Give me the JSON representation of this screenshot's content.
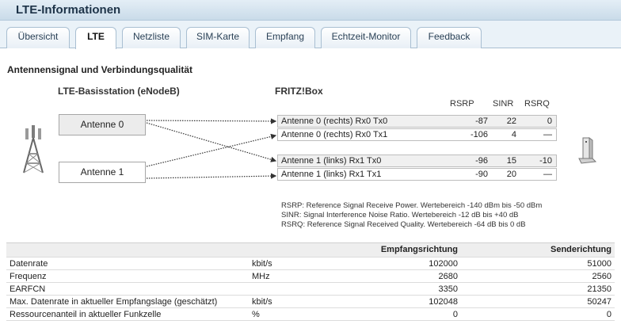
{
  "window": {
    "title": "LTE-Informationen"
  },
  "tabs": [
    {
      "label": "Übersicht"
    },
    {
      "label": "LTE"
    },
    {
      "label": "Netzliste"
    },
    {
      "label": "SIM-Karte"
    },
    {
      "label": "Empfang"
    },
    {
      "label": "Echtzeit-Monitor"
    },
    {
      "label": "Feedback"
    }
  ],
  "section": {
    "title": "Antennensignal und Verbindungsqualität"
  },
  "station": {
    "heading": "LTE-Basisstation (eNodeB)",
    "antennas": [
      "Antenne 0",
      "Antenne 1"
    ]
  },
  "fritzbox": {
    "heading": "FRITZ!Box",
    "columns": [
      "RSRP",
      "SINR",
      "RSRQ"
    ],
    "rows": [
      {
        "label": "Antenne 0 (rechts) Rx0 Tx0",
        "rsrp": "-87",
        "sinr": "22",
        "rsrq": "0"
      },
      {
        "label": "Antenne 0 (rechts) Rx0 Tx1",
        "rsrp": "-106",
        "sinr": "4",
        "rsrq": "—"
      },
      {
        "label": "Antenne 1 (links) Rx1 Tx0",
        "rsrp": "-96",
        "sinr": "15",
        "rsrq": "-10"
      },
      {
        "label": "Antenne 1 (links) Rx1 Tx1",
        "rsrp": "-90",
        "sinr": "20",
        "rsrq": "—"
      }
    ]
  },
  "legend": [
    "RSRP: Reference Signal Receive Power. Wertebereich -140 dBm bis -50 dBm",
    "SINR: Signal Interference Noise Ratio. Wertebereich -12 dB bis +40 dB",
    "RSRQ: Reference Signal Received Quality. Wertebereich -64 dB bis 0 dB"
  ],
  "table": {
    "headers": [
      "",
      "",
      "Empfangsrichtung",
      "Senderichtung"
    ],
    "rows": [
      {
        "label": "Datenrate",
        "unit": "kbit/s",
        "rx": "102000",
        "tx": "51000"
      },
      {
        "label": "Frequenz",
        "unit": "MHz",
        "rx": "2680",
        "tx": "2560"
      },
      {
        "label": "EARFCN",
        "unit": "",
        "rx": "3350",
        "tx": "21350"
      },
      {
        "label": "Max. Datenrate in aktueller Empfangslage (geschätzt)",
        "unit": "kbit/s",
        "rx": "102048",
        "tx": "50247"
      },
      {
        "label": "Ressourcenanteil in aktueller Funkzelle",
        "unit": "%",
        "rx": "0",
        "tx": "0"
      }
    ]
  },
  "icons": {
    "tower": "cell-tower-icon",
    "router": "fritzbox-router-icon"
  }
}
